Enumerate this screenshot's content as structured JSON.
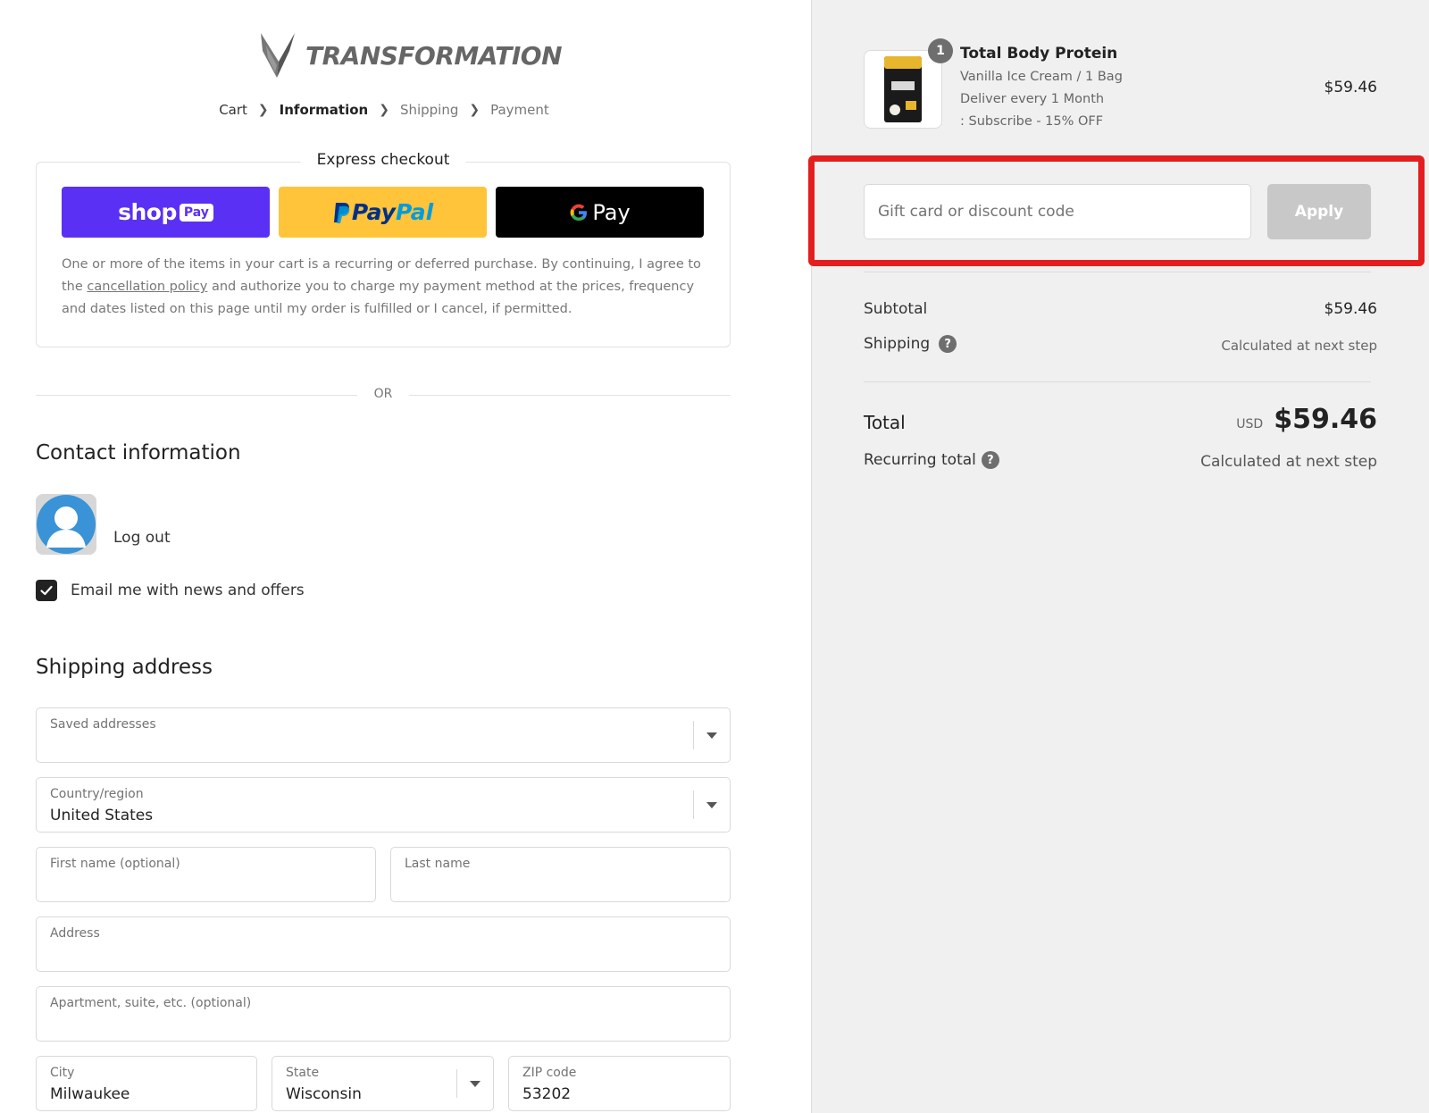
{
  "brand": {
    "name": "TRANSFORMATION"
  },
  "breadcrumb": [
    {
      "label": "Cart",
      "state": "done"
    },
    {
      "label": "Information",
      "state": "current"
    },
    {
      "label": "Shipping",
      "state": "future"
    },
    {
      "label": "Payment",
      "state": "future"
    }
  ],
  "express": {
    "title": "Express checkout",
    "shop_word": "shop",
    "shop_pay": "Pay",
    "paypal_p1": "Pay",
    "paypal_p2": "Pal",
    "gpay_word": "Pay",
    "note_before": "One or more of the items in your cart is a recurring or deferred purchase. By continuing, I agree to the ",
    "note_link": "cancellation policy",
    "note_after": " and authorize you to charge my payment method at the prices, frequency and dates listed on this page until my order is fulfilled or I cancel, if permitted."
  },
  "divider": {
    "or": "OR"
  },
  "contact": {
    "heading": "Contact information",
    "logout": "Log out",
    "newsletter_label": "Email me with news and offers",
    "newsletter_checked": true
  },
  "shipping": {
    "heading": "Shipping address",
    "saved_label": "Saved addresses",
    "country_label": "Country/region",
    "country_value": "United States",
    "first_label": "First name (optional)",
    "last_label": "Last name",
    "address_label": "Address",
    "apt_label": "Apartment, suite, etc. (optional)",
    "city_label": "City",
    "city_value": "Milwaukee",
    "state_label": "State",
    "state_value": "Wisconsin",
    "zip_label": "ZIP code",
    "zip_value": "53202"
  },
  "summary": {
    "product": {
      "name": "Total Body Protein",
      "variant": "Vanilla Ice Cream / 1 Bag",
      "delivery": "Deliver every 1 Month",
      "plan": ": Subscribe - 15% OFF",
      "price": "$59.46",
      "quantity": "1"
    },
    "discount_placeholder": "Gift card or discount code",
    "apply_label": "Apply",
    "subtotal_label": "Subtotal",
    "subtotal_value": "$59.46",
    "shipping_label": "Shipping",
    "shipping_value": "Calculated at next step",
    "total_label": "Total",
    "currency": "USD",
    "total_value": "$59.46",
    "recurring_label": "Recurring total",
    "recurring_value": "Calculated at next step"
  },
  "colors": {
    "shop_pay": "#5a31f4",
    "paypal": "#ffc439",
    "highlight": "#e41e1e"
  }
}
